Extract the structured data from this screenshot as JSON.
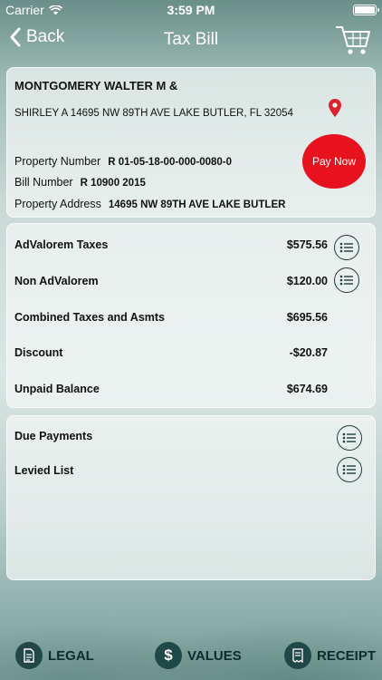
{
  "status": {
    "carrier": "Carrier",
    "time": "3:59 PM"
  },
  "nav": {
    "back_label": "Back",
    "title": "Tax Bill"
  },
  "bill": {
    "owner_line1": "MONTGOMERY WALTER M &",
    "owner_line2": "SHIRLEY A 14695 NW 89TH AVE LAKE BUTLER, FL  32054",
    "property_number_label": "Property Number",
    "property_number": "R 01-05-18-00-000-0080-0",
    "bill_number_label": "Bill Number",
    "bill_number": "R 10900 2015",
    "property_address_label": "Property Address",
    "property_address": "14695 NW 89TH AVE LAKE BUTLER",
    "pay_now_label": "Pay Now"
  },
  "taxes": {
    "rows": [
      {
        "label": "AdValorem Taxes",
        "amount": "$575.56"
      },
      {
        "label": "Non AdValorem",
        "amount": "$120.00"
      },
      {
        "label": "Combined Taxes and Asmts",
        "amount": "$695.56"
      },
      {
        "label": "Discount",
        "amount": "-$20.87"
      },
      {
        "label": "Unpaid Balance",
        "amount": "$674.69"
      }
    ]
  },
  "lists": {
    "due_payments": "Due Payments",
    "levied_list": "Levied List"
  },
  "tabbar": {
    "legal": "LEGAL",
    "values": "VALUES",
    "receipt": "RECEIPT"
  },
  "colors": {
    "pay_now": "#e8121f",
    "accent": "#1f4846"
  }
}
